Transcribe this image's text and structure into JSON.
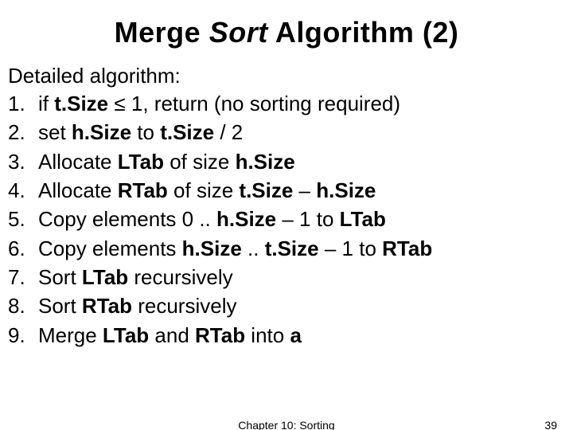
{
  "title": {
    "pre": "Merge ",
    "italic": "Sort",
    "post": " Algorithm (2)"
  },
  "intro": "Detailed algorithm:",
  "steps": [
    {
      "n": "1.",
      "html": "if <span class=\"b\">t.Size</span> ≤ 1, return (no sorting required)"
    },
    {
      "n": "2.",
      "html": "set <span class=\"b\">h.Size</span> to <span class=\"b\">t.Size</span> / 2"
    },
    {
      "n": "3.",
      "html": "Allocate <span class=\"b\">LTab</span> of size <span class=\"b\">h.Size</span>"
    },
    {
      "n": "4.",
      "html": "Allocate <span class=\"b\">RTab</span> of size <span class=\"b\">t.Size</span> – <span class=\"b\">h.Size</span>"
    },
    {
      "n": "5.",
      "html": "Copy elements 0 .. <span class=\"b\">h.Size</span> – 1 to <span class=\"b\">LTab</span>"
    },
    {
      "n": "6.",
      "html": "Copy elements <span class=\"b\">h.Size</span> .. <span class=\"b\">t.Size</span> – 1 to <span class=\"b\">RTab</span>"
    },
    {
      "n": "7.",
      "html": "Sort <span class=\"b\">LTab</span> recursively"
    },
    {
      "n": "8.",
      "html": "Sort <span class=\"b\">RTab</span> recursively"
    },
    {
      "n": "9.",
      "html": "Merge <span class=\"b\">LTab</span> and <span class=\"b\">RTab</span> into <span class=\"b\">a</span>"
    }
  ],
  "footer": {
    "chapter": "Chapter 10: Sorting",
    "page": "39"
  }
}
